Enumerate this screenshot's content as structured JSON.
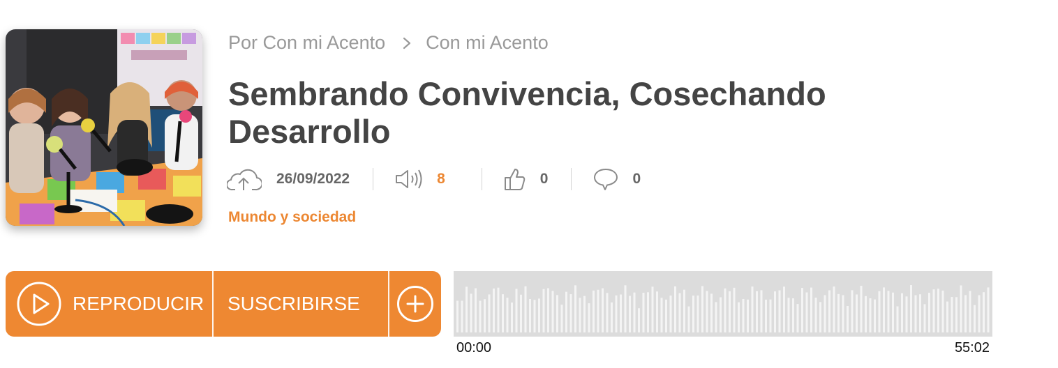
{
  "episode": {
    "cover_alt": "Episode cover image",
    "breadcrumb": [
      "Por Con mi Acento",
      "Con mi Acento"
    ],
    "title": "Sembrando Convivencia, Cosechando Desarrollo",
    "stats": {
      "date": "26/09/2022",
      "plays": "8",
      "likes": "0",
      "comments": "0"
    },
    "category": "Mundo y sociedad"
  },
  "actions": {
    "play_label": "REPRODUCIR",
    "subscribe_label": "SUSCRIBIRSE"
  },
  "player": {
    "time_start": "00:00",
    "time_end": "55:02"
  },
  "colors": {
    "accent": "#ee8832",
    "plays_value": "#ec8732",
    "waveform_bg": "#dcdcdc",
    "waveform_bar": "#f4f4f4"
  },
  "icons": [
    "upload-cloud-icon",
    "speaker-icon",
    "thumbs-up-icon",
    "comment-icon",
    "play-icon",
    "plus-icon",
    "chevron-right-icon"
  ]
}
